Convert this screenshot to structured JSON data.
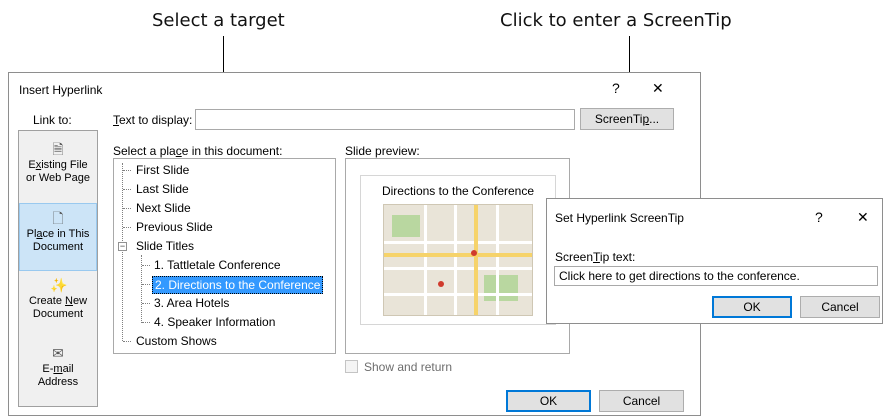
{
  "callouts": {
    "select_target": "Select a target",
    "screentip": "Click to enter a ScreenTip"
  },
  "dialog": {
    "title": "Insert Hyperlink",
    "help_glyph": "?",
    "close_glyph": "✕",
    "link_to_label": "Link to:",
    "text_to_display": {
      "label_prefix": "",
      "label_u": "T",
      "label_rest": "ext to display:",
      "value": ""
    },
    "screentip_button": {
      "prefix": "ScreenTi",
      "u": "p",
      "suffix": "..."
    },
    "select_place_label": {
      "prefix": "Select a pla",
      "u": "c",
      "suffix": "e in this document:"
    },
    "slide_preview_label": "Slide preview:",
    "link_options": [
      {
        "line1_prefix": "E",
        "line1_u": "x",
        "line1_suffix": "isting File",
        "line2": "or Web Page",
        "icon": "existing-file-icon"
      },
      {
        "line1_prefix": "Pl",
        "line1_u": "a",
        "line1_suffix": "ce in This",
        "line2": "Document",
        "icon": "place-in-document-icon"
      },
      {
        "line1_prefix": "Create ",
        "line1_u": "N",
        "line1_suffix": "ew",
        "line2": "Document",
        "icon": "new-document-icon"
      },
      {
        "line1_prefix": "E-",
        "line1_u": "m",
        "line1_suffix": "ail",
        "line2": "Address",
        "icon": "email-icon"
      }
    ],
    "tree": {
      "top_items": [
        "First Slide",
        "Last Slide",
        "Next Slide",
        "Previous Slide"
      ],
      "slide_titles_label": "Slide Titles",
      "expander_glyph": "−",
      "slides": [
        "1. Tattletale Conference",
        "2. Directions to the Conference",
        "3. Area Hotels",
        "4. Speaker Information"
      ],
      "custom_shows": "Custom Shows"
    },
    "preview": {
      "slide_title": "Directions to the Conference"
    },
    "show_and_return": "Show and return",
    "ok": "OK",
    "cancel": "Cancel"
  },
  "screentip_dialog": {
    "title": "Set Hyperlink ScreenTip",
    "help_glyph": "?",
    "close_glyph": "✕",
    "label": {
      "prefix": "Screen",
      "u": "T",
      "suffix": "ip text:"
    },
    "value": "Click here to get directions to the conference.",
    "ok": "OK",
    "cancel": "Cancel"
  },
  "colors": {
    "selection": "#3399ff",
    "active_link": "#cce4f7",
    "default_button_border": "#0078d7"
  }
}
